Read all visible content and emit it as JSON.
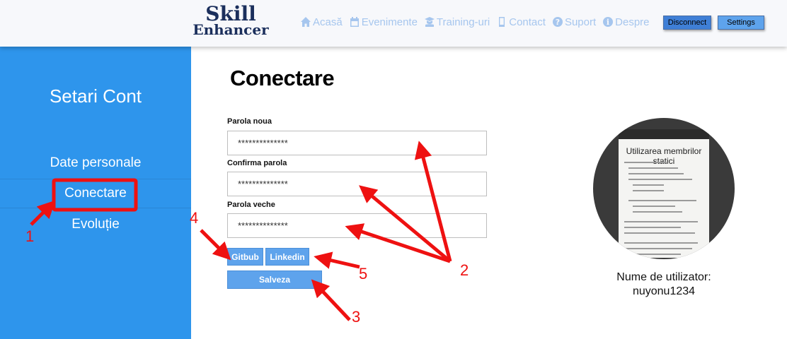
{
  "header": {
    "logo_line1": "Skill",
    "logo_line2": "Enhancer",
    "nav": [
      {
        "label": "Acasă",
        "icon": "home-icon"
      },
      {
        "label": "Evenimente",
        "icon": "calendar-icon"
      },
      {
        "label": "Training-uri",
        "icon": "graduate-icon"
      },
      {
        "label": "Contact",
        "icon": "mobile-icon"
      },
      {
        "label": "Suport",
        "icon": "question-icon"
      },
      {
        "label": "Despre",
        "icon": "info-icon"
      }
    ],
    "disconnect_label": "Disconnect",
    "settings_label": "Settings"
  },
  "sidebar": {
    "title": "Setari Cont",
    "items": [
      {
        "label": "Date personale"
      },
      {
        "label": "Conectare"
      },
      {
        "label": "Evoluție"
      }
    ]
  },
  "main": {
    "title": "Conectare",
    "fields": [
      {
        "label": "Parola noua",
        "value": "**************"
      },
      {
        "label": "Confirma parola",
        "value": "**************"
      },
      {
        "label": "Parola veche",
        "value": "**************"
      }
    ],
    "github_label": "Gitbub",
    "linkedin_label": "Linkedin",
    "save_label": "Salveza"
  },
  "profile": {
    "avatar_title": "Utilizarea membrilor statici",
    "username_label": "Nume de utilizator:",
    "username": "nuyonu1234"
  },
  "annotations": {
    "numbers": [
      "1",
      "2",
      "3",
      "4",
      "5"
    ],
    "color": "#ee1111"
  },
  "colors": {
    "sidebar_bg": "#2e95ec",
    "button_bg": "#5ea3ec",
    "nav_text": "#a6c6ee"
  }
}
